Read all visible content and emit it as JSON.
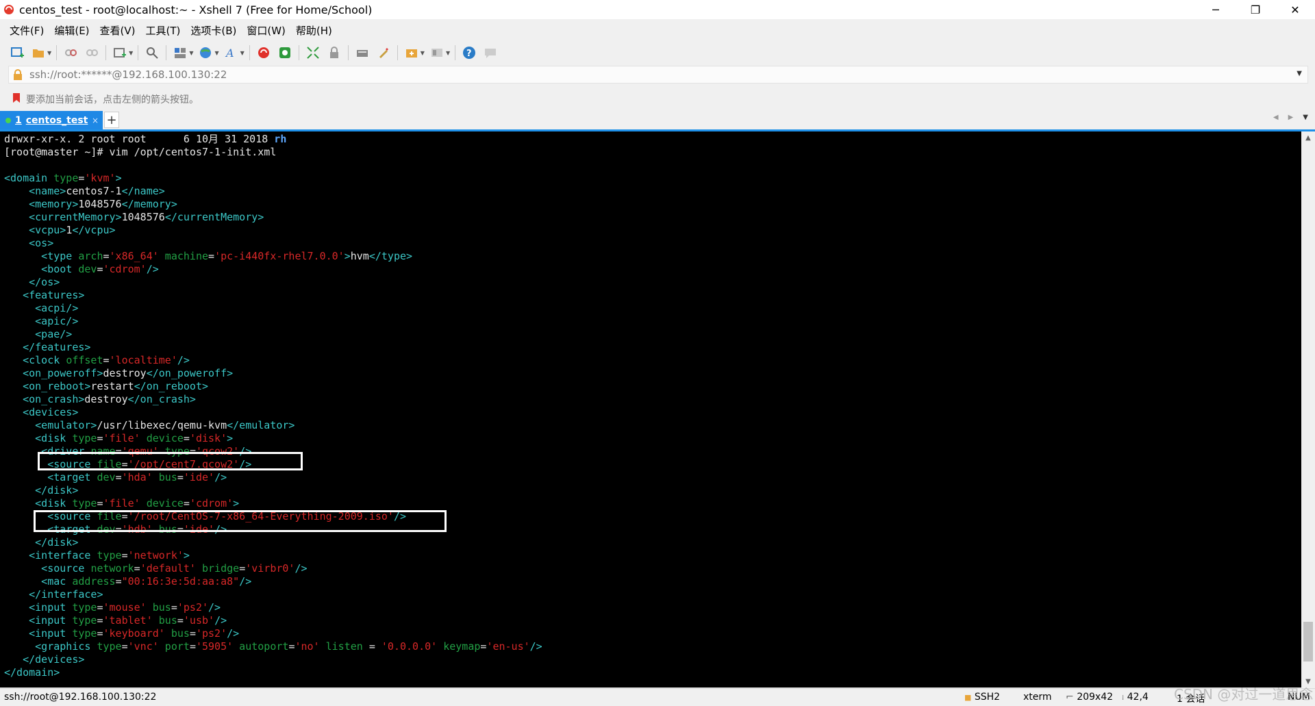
{
  "window": {
    "title": "centos_test - root@localhost:~ - Xshell 7 (Free for Home/School)",
    "minimize": "─",
    "restore": "❐",
    "close": "✕"
  },
  "menu": [
    "文件(F)",
    "编辑(E)",
    "查看(V)",
    "工具(T)",
    "选项卡(B)",
    "窗口(W)",
    "帮助(H)"
  ],
  "address": {
    "value": "ssh://root:******@192.168.100.130:22"
  },
  "hint": "要添加当前会话，点击左侧的箭头按钮。",
  "tab": {
    "number": "1",
    "label": "centos_test",
    "close": "×",
    "add": "+"
  },
  "terminal": {
    "lines": [
      [
        {
          "t": "drwxr-xr-x. 2 root root      6 10月 31 2018 ",
          "c": "txt"
        },
        {
          "t": "rh",
          "c": "dir"
        }
      ],
      [
        {
          "t": "[root@master ~]# vim /opt/centos7-1-init.xml",
          "c": "txt"
        }
      ],
      [],
      [
        {
          "t": "<domain ",
          "c": "tag"
        },
        {
          "t": "type",
          "c": "attr"
        },
        {
          "t": "=",
          "c": "txt"
        },
        {
          "t": "'kvm'",
          "c": "val"
        },
        {
          "t": ">",
          "c": "tag"
        }
      ],
      [
        {
          "t": "    <name>",
          "c": "tag"
        },
        {
          "t": "centos7-1",
          "c": "txt"
        },
        {
          "t": "</name>",
          "c": "tag"
        }
      ],
      [
        {
          "t": "    <memory>",
          "c": "tag"
        },
        {
          "t": "1048576",
          "c": "txt"
        },
        {
          "t": "</memory>",
          "c": "tag"
        }
      ],
      [
        {
          "t": "    <currentMemory>",
          "c": "tag"
        },
        {
          "t": "1048576",
          "c": "txt"
        },
        {
          "t": "</currentMemory>",
          "c": "tag"
        }
      ],
      [
        {
          "t": "    <vcpu>",
          "c": "tag"
        },
        {
          "t": "1",
          "c": "txt"
        },
        {
          "t": "</vcpu>",
          "c": "tag"
        }
      ],
      [
        {
          "t": "    <os>",
          "c": "tag"
        }
      ],
      [
        {
          "t": "      <type ",
          "c": "tag"
        },
        {
          "t": "arch",
          "c": "attr"
        },
        {
          "t": "=",
          "c": "txt"
        },
        {
          "t": "'x86_64'",
          "c": "val"
        },
        {
          "t": " machine",
          "c": "attr"
        },
        {
          "t": "=",
          "c": "txt"
        },
        {
          "t": "'pc-i440fx-rhel7.0.0'",
          "c": "val"
        },
        {
          "t": ">",
          "c": "tag"
        },
        {
          "t": "hvm",
          "c": "txt"
        },
        {
          "t": "</type>",
          "c": "tag"
        }
      ],
      [
        {
          "t": "      <boot ",
          "c": "tag"
        },
        {
          "t": "dev",
          "c": "attr"
        },
        {
          "t": "=",
          "c": "txt"
        },
        {
          "t": "'cdrom'",
          "c": "val"
        },
        {
          "t": "/>",
          "c": "tag"
        }
      ],
      [
        {
          "t": "    </os>",
          "c": "tag"
        }
      ],
      [
        {
          "t": "   <features>",
          "c": "tag"
        }
      ],
      [
        {
          "t": "     <acpi/>",
          "c": "tag"
        }
      ],
      [
        {
          "t": "     <apic/>",
          "c": "tag"
        }
      ],
      [
        {
          "t": "     <pae/>",
          "c": "tag"
        }
      ],
      [
        {
          "t": "   </features>",
          "c": "tag"
        }
      ],
      [
        {
          "t": "   <clock ",
          "c": "tag"
        },
        {
          "t": "offset",
          "c": "attr"
        },
        {
          "t": "=",
          "c": "txt"
        },
        {
          "t": "'localtime'",
          "c": "val"
        },
        {
          "t": "/>",
          "c": "tag"
        }
      ],
      [
        {
          "t": "   <on_poweroff>",
          "c": "tag"
        },
        {
          "t": "destroy",
          "c": "txt"
        },
        {
          "t": "</on_poweroff>",
          "c": "tag"
        }
      ],
      [
        {
          "t": "   <on_reboot>",
          "c": "tag"
        },
        {
          "t": "restart",
          "c": "txt"
        },
        {
          "t": "</on_reboot>",
          "c": "tag"
        }
      ],
      [
        {
          "t": "   <on_crash>",
          "c": "tag"
        },
        {
          "t": "destroy",
          "c": "txt"
        },
        {
          "t": "</on_crash>",
          "c": "tag"
        }
      ],
      [
        {
          "t": "   <devices>",
          "c": "tag"
        }
      ],
      [
        {
          "t": "     <emulator>",
          "c": "tag"
        },
        {
          "t": "/usr/libexec/qemu-kvm",
          "c": "txt"
        },
        {
          "t": "</emulator>",
          "c": "tag"
        }
      ],
      [
        {
          "t": "     <disk ",
          "c": "tag"
        },
        {
          "t": "type",
          "c": "attr"
        },
        {
          "t": "=",
          "c": "txt"
        },
        {
          "t": "'file'",
          "c": "val"
        },
        {
          "t": " device",
          "c": "attr"
        },
        {
          "t": "=",
          "c": "txt"
        },
        {
          "t": "'disk'",
          "c": "val"
        },
        {
          "t": ">",
          "c": "tag"
        }
      ],
      [
        {
          "t": "      <driver ",
          "c": "tag"
        },
        {
          "t": "name",
          "c": "attr"
        },
        {
          "t": "=",
          "c": "txt"
        },
        {
          "t": "'qemu'",
          "c": "val"
        },
        {
          "t": " type",
          "c": "attr"
        },
        {
          "t": "=",
          "c": "txt"
        },
        {
          "t": "'qcow2'",
          "c": "val"
        },
        {
          "t": "/>",
          "c": "tag"
        }
      ],
      [
        {
          "t": "       <source ",
          "c": "tag"
        },
        {
          "t": "file",
          "c": "attr"
        },
        {
          "t": "=",
          "c": "txt"
        },
        {
          "t": "'/opt/cent7.qcow2'",
          "c": "val"
        },
        {
          "t": "/>",
          "c": "tag"
        }
      ],
      [
        {
          "t": "       <target ",
          "c": "tag"
        },
        {
          "t": "dev",
          "c": "attr"
        },
        {
          "t": "=",
          "c": "txt"
        },
        {
          "t": "'hda'",
          "c": "val"
        },
        {
          "t": " bus",
          "c": "attr"
        },
        {
          "t": "=",
          "c": "txt"
        },
        {
          "t": "'ide'",
          "c": "val"
        },
        {
          "t": "/>",
          "c": "tag"
        }
      ],
      [
        {
          "t": "     </disk>",
          "c": "tag"
        }
      ],
      [
        {
          "t": "     <disk ",
          "c": "tag"
        },
        {
          "t": "type",
          "c": "attr"
        },
        {
          "t": "=",
          "c": "txt"
        },
        {
          "t": "'file'",
          "c": "val"
        },
        {
          "t": " device",
          "c": "attr"
        },
        {
          "t": "=",
          "c": "txt"
        },
        {
          "t": "'cdrom'",
          "c": "val"
        },
        {
          "t": ">",
          "c": "tag"
        }
      ],
      [
        {
          "t": "       <source ",
          "c": "tag"
        },
        {
          "t": "file",
          "c": "attr"
        },
        {
          "t": "=",
          "c": "txt"
        },
        {
          "t": "'/root/CentOS-7-x86_64-Everything-2009.iso'",
          "c": "val"
        },
        {
          "t": "/>",
          "c": "tag"
        }
      ],
      [
        {
          "t": "       <target ",
          "c": "tag"
        },
        {
          "t": "dev",
          "c": "attr"
        },
        {
          "t": "=",
          "c": "txt"
        },
        {
          "t": "'hdb'",
          "c": "val"
        },
        {
          "t": " bus",
          "c": "attr"
        },
        {
          "t": "=",
          "c": "txt"
        },
        {
          "t": "'ide'",
          "c": "val"
        },
        {
          "t": "/>",
          "c": "tag"
        }
      ],
      [
        {
          "t": "     </disk>",
          "c": "tag"
        }
      ],
      [
        {
          "t": "    <interface ",
          "c": "tag"
        },
        {
          "t": "type",
          "c": "attr"
        },
        {
          "t": "=",
          "c": "txt"
        },
        {
          "t": "'network'",
          "c": "val"
        },
        {
          "t": ">",
          "c": "tag"
        }
      ],
      [
        {
          "t": "      <source ",
          "c": "tag"
        },
        {
          "t": "network",
          "c": "attr"
        },
        {
          "t": "=",
          "c": "txt"
        },
        {
          "t": "'default'",
          "c": "val"
        },
        {
          "t": " bridge",
          "c": "attr"
        },
        {
          "t": "=",
          "c": "txt"
        },
        {
          "t": "'virbr0'",
          "c": "val"
        },
        {
          "t": "/>",
          "c": "tag"
        }
      ],
      [
        {
          "t": "      <mac ",
          "c": "tag"
        },
        {
          "t": "address",
          "c": "attr"
        },
        {
          "t": "=",
          "c": "txt"
        },
        {
          "t": "\"00:16:3e:5d:aa:a8\"",
          "c": "val"
        },
        {
          "t": "/>",
          "c": "tag"
        }
      ],
      [
        {
          "t": "    </interface>",
          "c": "tag"
        }
      ],
      [
        {
          "t": "    <input ",
          "c": "tag"
        },
        {
          "t": "type",
          "c": "attr"
        },
        {
          "t": "=",
          "c": "txt"
        },
        {
          "t": "'mouse'",
          "c": "val"
        },
        {
          "t": " bus",
          "c": "attr"
        },
        {
          "t": "=",
          "c": "txt"
        },
        {
          "t": "'ps2'",
          "c": "val"
        },
        {
          "t": "/>",
          "c": "tag"
        }
      ],
      [
        {
          "t": "    <input ",
          "c": "tag"
        },
        {
          "t": "type",
          "c": "attr"
        },
        {
          "t": "=",
          "c": "txt"
        },
        {
          "t": "'tablet'",
          "c": "val"
        },
        {
          "t": " bus",
          "c": "attr"
        },
        {
          "t": "=",
          "c": "txt"
        },
        {
          "t": "'usb'",
          "c": "val"
        },
        {
          "t": "/>",
          "c": "tag"
        }
      ],
      [
        {
          "t": "    <input ",
          "c": "tag"
        },
        {
          "t": "type",
          "c": "attr"
        },
        {
          "t": "=",
          "c": "txt"
        },
        {
          "t": "'keyboard'",
          "c": "val"
        },
        {
          "t": " bus",
          "c": "attr"
        },
        {
          "t": "=",
          "c": "txt"
        },
        {
          "t": "'ps2'",
          "c": "val"
        },
        {
          "t": "/>",
          "c": "tag"
        }
      ],
      [
        {
          "t": "     <graphics ",
          "c": "tag"
        },
        {
          "t": "type",
          "c": "attr"
        },
        {
          "t": "=",
          "c": "txt"
        },
        {
          "t": "'vnc'",
          "c": "val"
        },
        {
          "t": " port",
          "c": "attr"
        },
        {
          "t": "=",
          "c": "txt"
        },
        {
          "t": "'5905'",
          "c": "val"
        },
        {
          "t": " autoport",
          "c": "attr"
        },
        {
          "t": "=",
          "c": "txt"
        },
        {
          "t": "'no'",
          "c": "val"
        },
        {
          "t": " listen",
          "c": "attr"
        },
        {
          "t": " = ",
          "c": "txt"
        },
        {
          "t": "'0.0.0.0'",
          "c": "val"
        },
        {
          "t": " keymap",
          "c": "attr"
        },
        {
          "t": "=",
          "c": "txt"
        },
        {
          "t": "'en-us'",
          "c": "val"
        },
        {
          "t": "/>",
          "c": "tag"
        }
      ],
      [
        {
          "t": "   </devices>",
          "c": "tag"
        }
      ],
      [
        {
          "t": "</domain>",
          "c": "tag"
        }
      ]
    ]
  },
  "status": {
    "connection": "ssh://root@192.168.100.130:22",
    "protocol": "SSH2",
    "terminal_type": "xterm",
    "size": "209x42",
    "cursor": "42,4",
    "sessions": "1 会话",
    "num": "NUM"
  },
  "watermark": "CSDN @对过一道思念",
  "colors": {
    "terminal_bg": "#000000",
    "tag": "#3cc8c8",
    "attribute": "#22a045",
    "value": "#d82828",
    "text": "#e8e8e8",
    "tab_active": "#1e88e5"
  }
}
